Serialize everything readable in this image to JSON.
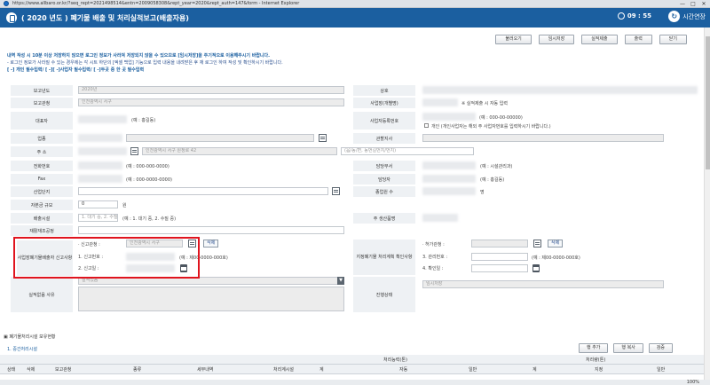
{
  "browser": {
    "url": "https://www.allbaro.or.kr/?seq_rept=2021498514&entn=2009058308&rept_year=2020&rept_auth=147&form - Internet Explorer"
  },
  "window": {
    "minimize": "—",
    "maximize": "□",
    "close": "✕"
  },
  "title": {
    "text": "( 2020 년도 ) 폐기물 배출 및 처리실적보고(배출자용)",
    "timer": "09 : 55",
    "extend": "시간연장"
  },
  "toolbar": {
    "buttons": [
      "불러오기",
      "임시저장",
      "실적제출",
      "출력",
      "닫기"
    ]
  },
  "notice": {
    "line1": "내역 작성 시 10분 이상 저장하지 않으면 로그인 정보가 사라져 저장되지 않을 수 있으므로 [임시저장]을 주기적으로 이용해주시기 바랍니다.",
    "line2": "- 로그인 정보가 사라질 수 있는 경우에는 각 시트 하단의 [엑셀 백업] 기능으로 입력 내용을 내려받은 후 재 로그인 하여 작성 및 확인하시기 바랍니다.",
    "line3": "[ -] 개인 필수입력/ [ -][ -]사업자 필수입력/ [ -]두곳 중 한 곳 필수입력"
  },
  "form": {
    "report_year_label": "보고년도",
    "report_year": "2020년",
    "report_org_label": "보고관청",
    "report_org": "인천광역시 서구",
    "ceo_label": "대표자",
    "ceo_hint": "(예 : 홍길동)",
    "industry_label": "업종",
    "address_label": "주 소",
    "address_city": "인천광역시 서구 원정로 42",
    "address_hint": "(읍/동/면, 동번길번지/번지)",
    "phone_label": "전화번호",
    "phone_hint": "(예 : 000-000-0000)",
    "fax_label": "Fax",
    "fax_hint": "(예 : 000-0000-0000)",
    "complex_label": "산업단지",
    "capital_label": "자본금 규모",
    "capital_value": "0",
    "capital_unit": "원",
    "facility_label": "배출시설",
    "facility_placeholder": "1. 대기 중, 2. 수질 중",
    "facility_hint": "(예 : 1. 대기 중, 2. 수질 중)",
    "process_label": "재활재조공정",
    "company_label": "상호",
    "regno_label": "사업장(개별명)",
    "regno_hint": "※ 실적제출 시 자동 입력",
    "bizno_label": "사업자등록번호",
    "bizno_hint": "(예 : 000-00-00000)",
    "personal_check": "개인 (개인사업자는 해외 주 사업자번호를 입력하시기 바랍니다.)",
    "jurisdiction_label": "관할지사",
    "handling_label": "담당부서",
    "handling_hint": "(예 : 시설관리과)",
    "manager_label": "담당자",
    "manager_hint": "(예 : 홍길동)",
    "employees_label": "종업원 수",
    "employees_unit": "명",
    "production_label": "주 생산품명",
    "report_box_title": "사업장폐기물배출자 신고사항",
    "report_org2_label": "· 신고관청 :",
    "report_org2": "인천광역시 서구",
    "report_no_label": "1. 신고번호 :",
    "report_no_hint": "(예 : 제00-0000-000호)",
    "report_date_label": "2. 신고일 :",
    "delete": "삭제",
    "treat_box_title": "지정폐기물 처리계획 확인사항",
    "permit_label": "· 허가관청 :",
    "confirm_no_label": "3. 관리번호 :",
    "confirm_no_hint": "(예 : 제00-0000-000호)",
    "confirm_date_label": "4. 확인일 :",
    "no_record_label": "실적없음 사유",
    "no_record_value": "실적있음",
    "progress_label": "진행상태",
    "progress_value": "임시저장"
  },
  "lower": {
    "section": "폐기물처리시설 보유현황",
    "sub": "1. 중간처리시설",
    "buttons": [
      "행 추가",
      "행 복사",
      "검증"
    ]
  },
  "grid": {
    "head1": [
      "처리능력(톤)",
      "처리량(톤)"
    ],
    "head2": [
      "상태",
      "삭제",
      "보고관청",
      "종류",
      "세부내역",
      "처리계시설",
      "계",
      "자동",
      "일반",
      "계",
      "지정",
      "일반"
    ]
  },
  "status": {
    "zoom": "100%"
  }
}
